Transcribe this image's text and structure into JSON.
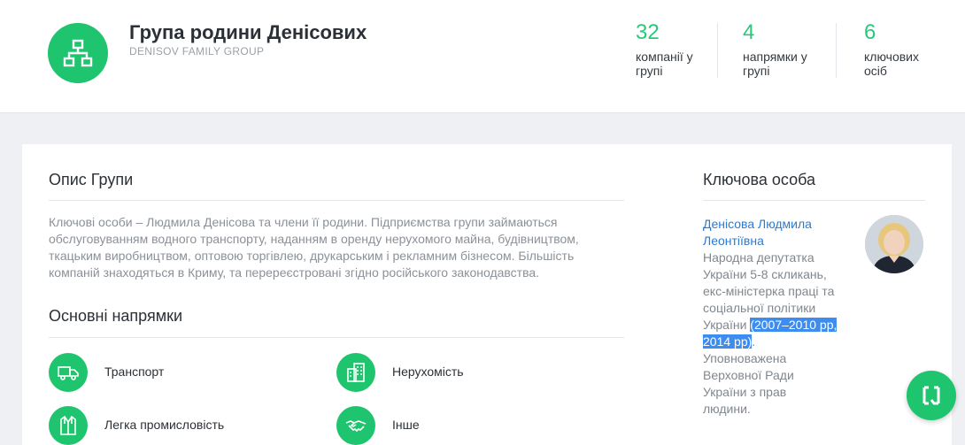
{
  "header": {
    "title": "Група родини Денісових",
    "subtitle": "DENISOV FAMILY GROUP",
    "logo_icon": "org-structure-icon",
    "stats": [
      {
        "value": "32",
        "label_line1": "компанії у",
        "label_line2": "групі"
      },
      {
        "value": "4",
        "label_line1": "напрямки у",
        "label_line2": "групі"
      },
      {
        "value": "6",
        "label_line1": "ключових",
        "label_line2": "осіб"
      }
    ]
  },
  "description": {
    "title": "Опис Групи",
    "text": "Ключові особи – Людмила Денісова та члени її родини. Підприємства групи займаються обслуговуванням водного транспорту, наданням в оренду нерухомого майна, будівництвом, ткацьким виробництвом, оптовою торгівлею, друкарським і рекламним бізнесом. Більшість компаній знаходяться в Криму, та перереєстровані згідно російського законодавства."
  },
  "directions": {
    "title": "Основні напрямки",
    "items": [
      {
        "label": "Транспорт",
        "icon": "truck-icon"
      },
      {
        "label": "Нерухомість",
        "icon": "building-icon"
      },
      {
        "label": "Легка промисловість",
        "icon": "clothing-icon"
      },
      {
        "label": "Інше",
        "icon": "handshake-icon"
      }
    ]
  },
  "key_person": {
    "title": "Ключова особа",
    "name_line1": "Денісова Людмила",
    "name_line2": "Леонтіївна",
    "role_lines": [
      "Народна депутатка",
      "України 5-8 скликань,",
      "екс-міністерка праці та",
      "соціальної політики"
    ],
    "role_pre_highlight": "України ",
    "role_highlight_1": "(2007–2010 рр,",
    "role_highlight_2": "2014 рр)",
    "role_after_highlight": ".",
    "role_tail_lines": [
      "Уповноважена",
      "Верховної Ради",
      "України з прав",
      "людини."
    ]
  },
  "colors": {
    "accent": "#1fc46f",
    "link": "#2a7ad2",
    "selection": "#3d8cf0"
  },
  "fab": {
    "icon": "chat-icon"
  }
}
